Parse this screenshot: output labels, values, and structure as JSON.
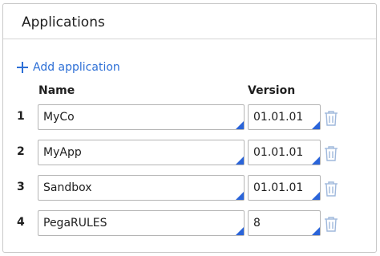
{
  "panel": {
    "title": "Applications",
    "add_label": "Add application",
    "columns": {
      "name": "Name",
      "version": "Version"
    },
    "rows": [
      {
        "index": "1",
        "name": "MyCo",
        "version": "01.01.01"
      },
      {
        "index": "2",
        "name": "MyApp",
        "version": "01.01.01"
      },
      {
        "index": "3",
        "name": "Sandbox",
        "version": "01.01.01"
      },
      {
        "index": "4",
        "name": "PegaRULES",
        "version": "8"
      }
    ]
  },
  "colors": {
    "accent": "#2d6fd6",
    "corner_marker": "#2a64d9",
    "trash_icon": "#9fb8dc"
  },
  "icons": {
    "add": "plus-icon",
    "delete": "trash-icon"
  }
}
